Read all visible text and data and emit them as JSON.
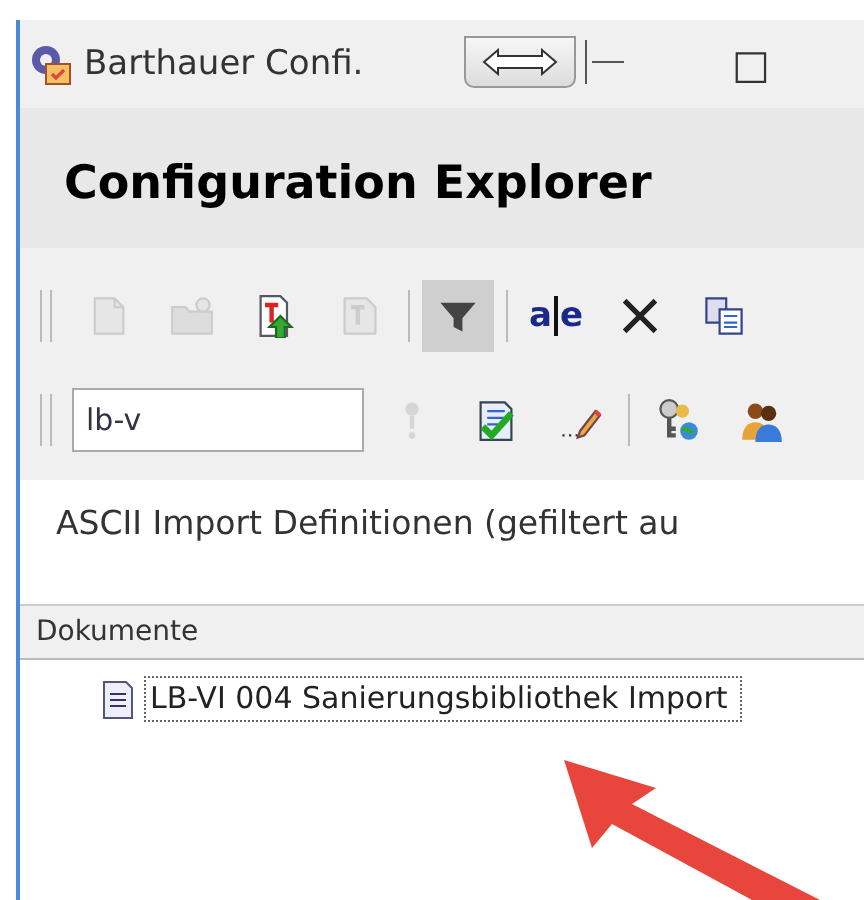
{
  "window": {
    "title": "Barthauer Confi.",
    "maximize": "□"
  },
  "header": {
    "title": "Configuration Explorer"
  },
  "toolbar1": [
    {
      "kind": "page",
      "disabled": true
    },
    {
      "kind": "folder",
      "disabled": true
    },
    {
      "kind": "upload",
      "disabled": false
    },
    {
      "kind": "page-t",
      "disabled": true
    },
    {
      "kind": "separator"
    },
    {
      "kind": "filter",
      "disabled": false,
      "pressed": true
    },
    {
      "kind": "separator"
    },
    {
      "kind": "rename",
      "disabled": false,
      "glyphs": [
        "a",
        "e"
      ]
    },
    {
      "kind": "delete",
      "disabled": false
    },
    {
      "kind": "copy",
      "disabled": false
    }
  ],
  "toolbar2": [
    {
      "kind": "field",
      "value": "lb-v"
    },
    {
      "kind": "exclamation",
      "disabled": true
    },
    {
      "kind": "check-doc",
      "disabled": false
    },
    {
      "kind": "pencil",
      "disabled": false
    },
    {
      "kind": "separator"
    },
    {
      "kind": "keys",
      "disabled": false
    },
    {
      "kind": "people",
      "disabled": false
    }
  ],
  "section_title": "ASCII Import Definitionen (gefiltert au",
  "table": {
    "columns": [
      "Dokumente"
    ],
    "rows": [
      {
        "name": "LB-VI 004 Sanierungsbibliothek Import",
        "selected": true
      }
    ]
  }
}
